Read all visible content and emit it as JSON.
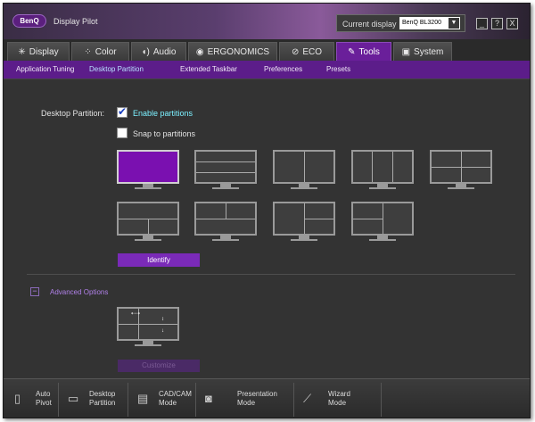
{
  "app": {
    "logo": "BenQ",
    "title": "Display Pilot"
  },
  "display": {
    "label": "Current display",
    "selected": "BenQ BL3200"
  },
  "window_buttons": {
    "minimize": "_",
    "help": "?",
    "close": "X"
  },
  "main_tabs": [
    {
      "label": "Display",
      "icon": "sun-icon"
    },
    {
      "label": "Color",
      "icon": "palette-icon"
    },
    {
      "label": "Audio",
      "icon": "speaker-icon"
    },
    {
      "label": "ERGONOMICS",
      "icon": "eye-icon"
    },
    {
      "label": "ECO",
      "icon": "leaf-icon"
    },
    {
      "label": "Tools",
      "icon": "wrench-icon"
    },
    {
      "label": "System",
      "icon": "monitor-icon"
    }
  ],
  "sub_tabs": [
    "Application Tuning",
    "Desktop Partition",
    "Extended Taskbar",
    "Preferences",
    "Presets"
  ],
  "partition": {
    "label": "Desktop Partition:",
    "enable_label": "Enable partitions",
    "enable_checked": true,
    "snap_label": "Snap to partitions",
    "snap_checked": false,
    "identify_label": "Identify"
  },
  "advanced": {
    "toggle": "−",
    "label": "Advanced Options",
    "customize_label": "Customize"
  },
  "bottom_bar": [
    {
      "line1": "Auto",
      "line2": "Pivot",
      "icon": "pivot-icon"
    },
    {
      "line1": "Desktop",
      "line2": "Partition",
      "icon": "partition-icon"
    },
    {
      "line1": "CAD/CAM",
      "line2": "Mode",
      "icon": "cad-icon"
    },
    {
      "line1": "Presentation",
      "line2": "Mode",
      "icon": "projector-icon"
    },
    {
      "line1": "Wizard",
      "line2": "Mode",
      "icon": "wand-icon"
    }
  ],
  "colors": {
    "accent": "#6a1f9a",
    "subbar": "#5c1d8a",
    "highlight": "#7cf0ff"
  }
}
